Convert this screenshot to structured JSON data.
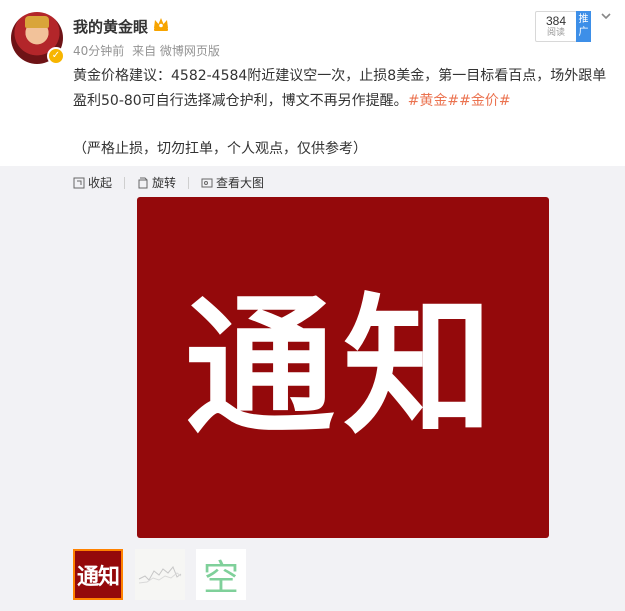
{
  "post": {
    "username": "我的黄金眼",
    "time": "40分钟前",
    "source": "来自 微博网页版",
    "read_count": "384",
    "read_label": "阅读",
    "promote_label": "推广",
    "text": "黄金价格建议：4582-4584附近建议空一次，止损8美金，第一目标看百点，场外跟单盈利50-80可自行选择减仓护利，博文不再另作提醒。",
    "tags": "#黄金##金价#",
    "note": "（严格止损，切勿扛单，个人观点，仅供参考）"
  },
  "toolbar": {
    "collapse_label": "收起",
    "rotate_label": "旋转",
    "view_large_label": "查看大图"
  },
  "media": {
    "main_image_text": "通知",
    "thumb1_text": "通知",
    "thumb3_text": "空",
    "main_bg": "#94090b",
    "thumb_selected_border": "#ff8200"
  },
  "icons": {
    "collapse": "collapse-icon",
    "rotate": "rotate-icon",
    "view_large": "view-large-icon",
    "more": "chevron-down-icon",
    "verified": "verified-badge-icon",
    "vip": "crown-icon"
  },
  "colors": {
    "tag": "#eb7350",
    "accent_blue": "#3d8fe8",
    "verified": "#f7b500"
  }
}
